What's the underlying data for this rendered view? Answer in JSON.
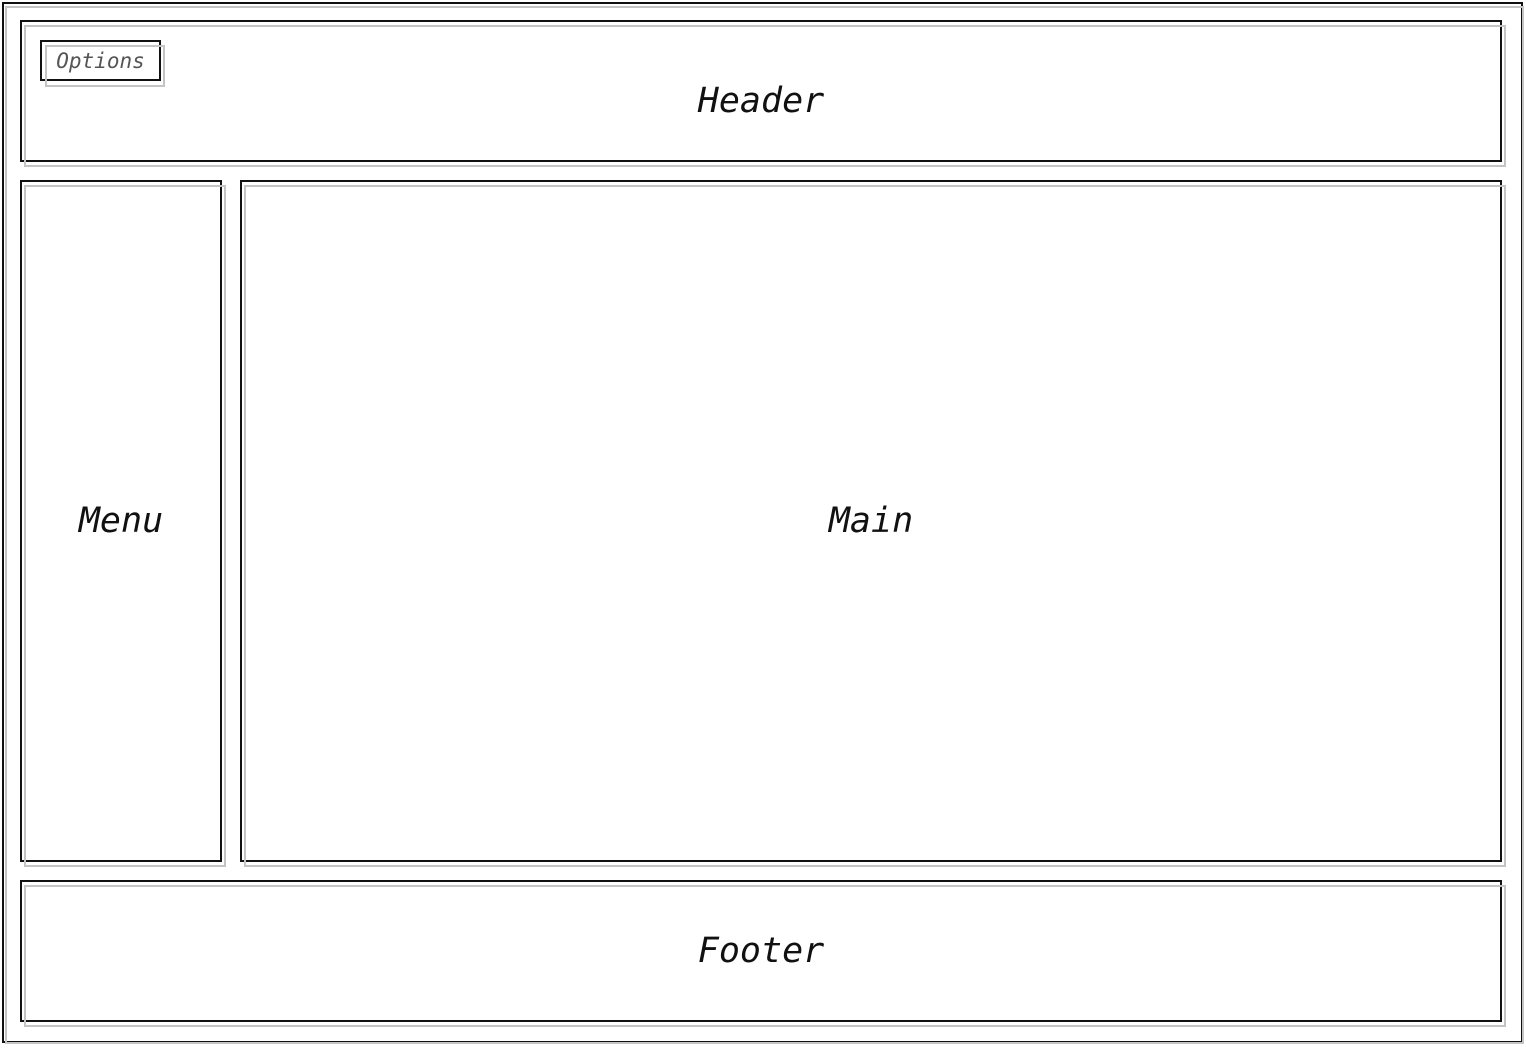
{
  "header": {
    "title": "Header",
    "options_label": "Options"
  },
  "menu": {
    "title": "Menu"
  },
  "main": {
    "title": "Main"
  },
  "footer": {
    "title": "Footer"
  },
  "colors": {
    "stroke": "#111111",
    "shadow": "#c4c4c4",
    "options_text": "#555555",
    "background": "#ffffff"
  }
}
